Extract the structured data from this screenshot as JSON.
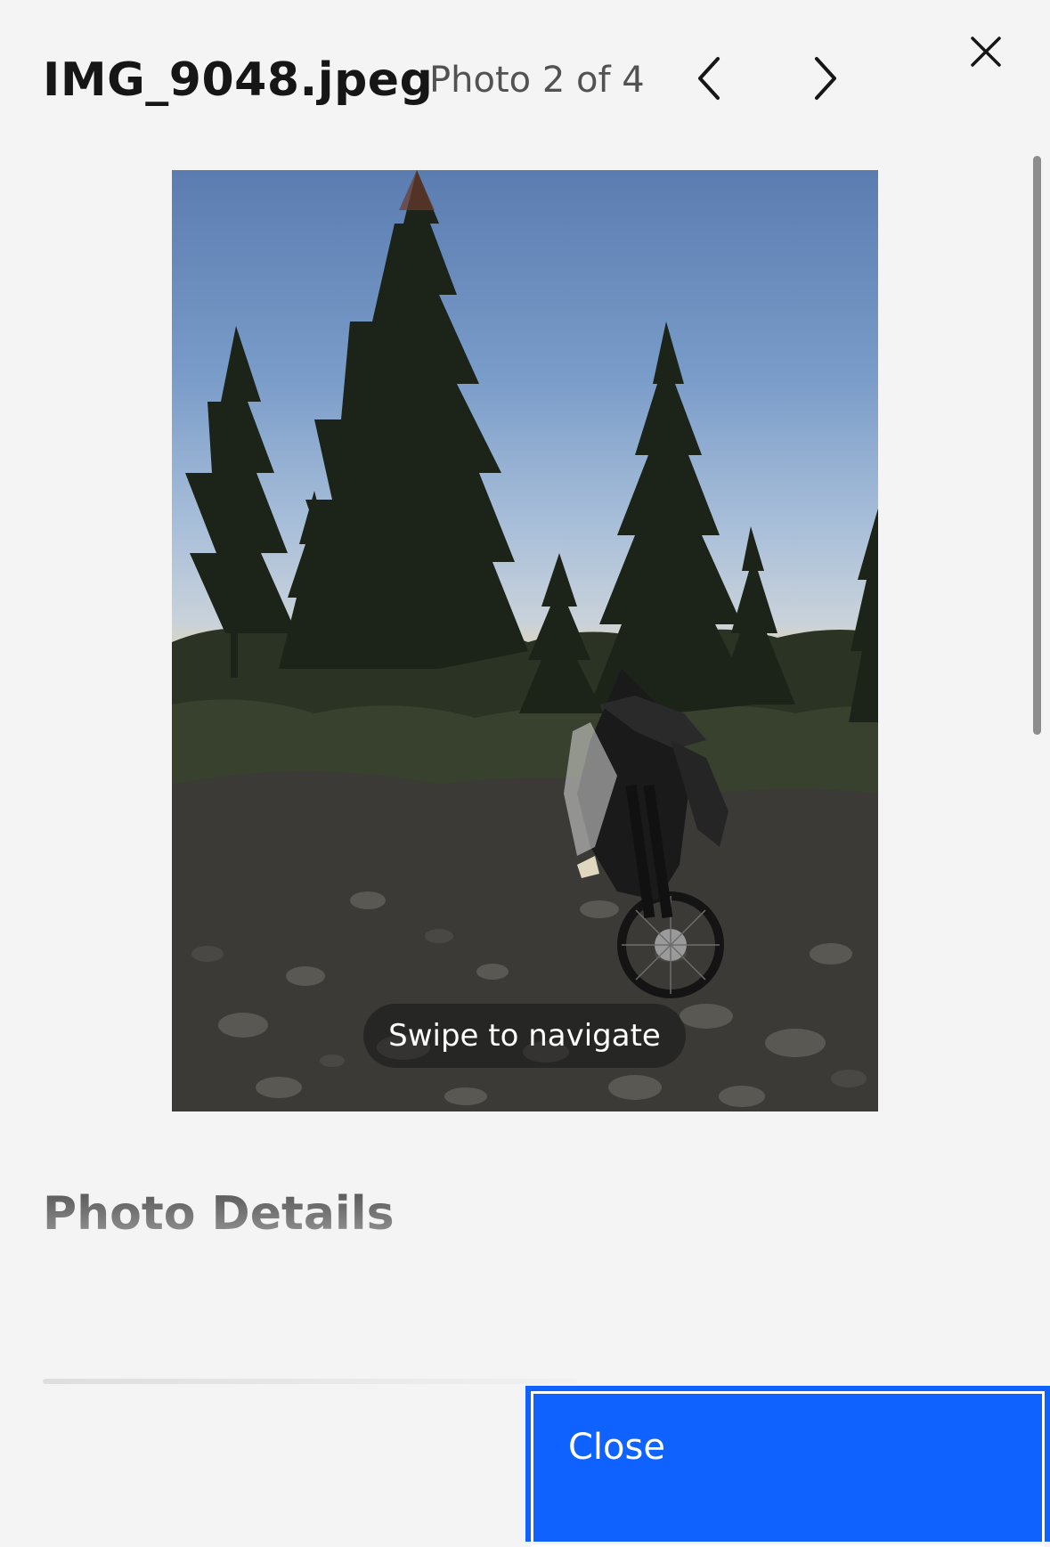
{
  "header": {
    "file_name": "IMG_9048.jpeg",
    "photo_counter": "Photo 2 of 4",
    "prev_icon": "chevron-left-icon",
    "next_icon": "chevron-right-icon",
    "close_icon": "close-icon"
  },
  "photo": {
    "swipe_hint": "Swipe to navigate"
  },
  "details": {
    "heading": "Photo Details"
  },
  "footer": {
    "close_label": "Close"
  },
  "colors": {
    "background": "#f4f4f4",
    "primary_button": "#0f62fe",
    "text_primary": "#161616",
    "text_secondary": "#525252"
  }
}
